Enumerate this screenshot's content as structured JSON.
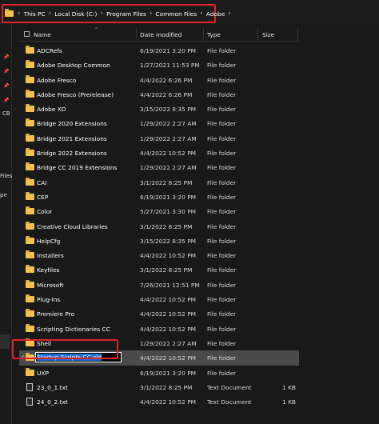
{
  "breadcrumb": {
    "items": [
      "This PC",
      "Local Disk (C:)",
      "Program Files",
      "Common Files",
      "Adobe"
    ],
    "separator": "›"
  },
  "nav_pane": {
    "labels": [
      "CB",
      "Files",
      "pe"
    ]
  },
  "columns": {
    "name": "Name",
    "date_modified": "Date modified",
    "type": "Type",
    "size": "Size"
  },
  "files": [
    {
      "name": "ADCRefs",
      "date": "6/19/2021 3:20 PM",
      "type": "File folder",
      "size": "",
      "kind": "folder"
    },
    {
      "name": "Adobe Desktop Common",
      "date": "1/27/2021 11:53 PM",
      "type": "File folder",
      "size": "",
      "kind": "folder"
    },
    {
      "name": "Adobe Fresco",
      "date": "4/4/2022 6:26 PM",
      "type": "File folder",
      "size": "",
      "kind": "folder"
    },
    {
      "name": "Adobe Fresco (Prerelease)",
      "date": "4/4/2022 6:26 PM",
      "type": "File folder",
      "size": "",
      "kind": "folder"
    },
    {
      "name": "Adobe XD",
      "date": "3/15/2022 8:35 PM",
      "type": "File folder",
      "size": "",
      "kind": "folder"
    },
    {
      "name": "Bridge 2020 Extensions",
      "date": "1/29/2022 2:27 AM",
      "type": "File folder",
      "size": "",
      "kind": "folder"
    },
    {
      "name": "Bridge 2021 Extensions",
      "date": "1/29/2022 2:27 AM",
      "type": "File folder",
      "size": "",
      "kind": "folder"
    },
    {
      "name": "Bridge 2022 Extensions",
      "date": "4/4/2022 10:52 PM",
      "type": "File folder",
      "size": "",
      "kind": "folder"
    },
    {
      "name": "Bridge CC 2019 Extensions",
      "date": "1/29/2022 2:27 AM",
      "type": "File folder",
      "size": "",
      "kind": "folder"
    },
    {
      "name": "CAI",
      "date": "3/1/2022 8:25 PM",
      "type": "File folder",
      "size": "",
      "kind": "folder"
    },
    {
      "name": "CEP",
      "date": "6/19/2021 3:20 PM",
      "type": "File folder",
      "size": "",
      "kind": "folder"
    },
    {
      "name": "Color",
      "date": "5/27/2021 3:30 PM",
      "type": "File folder",
      "size": "",
      "kind": "folder"
    },
    {
      "name": "Creative Cloud Libraries",
      "date": "3/1/2022 8:25 PM",
      "type": "File folder",
      "size": "",
      "kind": "folder"
    },
    {
      "name": "HelpCfg",
      "date": "3/15/2022 8:35 PM",
      "type": "File folder",
      "size": "",
      "kind": "folder"
    },
    {
      "name": "Installers",
      "date": "4/4/2022 10:52 PM",
      "type": "File folder",
      "size": "",
      "kind": "folder"
    },
    {
      "name": "Keyfiles",
      "date": "3/1/2022 8:25 PM",
      "type": "File folder",
      "size": "",
      "kind": "folder"
    },
    {
      "name": "Microsoft",
      "date": "7/26/2021 12:51 PM",
      "type": "File folder",
      "size": "",
      "kind": "folder"
    },
    {
      "name": "Plug-Ins",
      "date": "4/4/2022 10:52 PM",
      "type": "File folder",
      "size": "",
      "kind": "folder"
    },
    {
      "name": "Premiere Pro",
      "date": "4/4/2022 10:52 PM",
      "type": "File folder",
      "size": "",
      "kind": "folder"
    },
    {
      "name": "Scripting Dictionaries CC",
      "date": "4/4/2022 10:52 PM",
      "type": "File folder",
      "size": "",
      "kind": "folder"
    },
    {
      "name": "Shell",
      "date": "1/29/2022 2:27 AM",
      "type": "File folder",
      "size": "",
      "kind": "folder"
    },
    {
      "name": "Startup Scripts CC.old",
      "date": "4/4/2022 10:52 PM",
      "type": "File folder",
      "size": "",
      "kind": "folder",
      "selected": true,
      "renaming": true
    },
    {
      "name": "UXP",
      "date": "6/19/2021 3:20 PM",
      "type": "File folder",
      "size": "",
      "kind": "folder"
    },
    {
      "name": "23_0_1.txt",
      "date": "3/1/2022 8:25 PM",
      "type": "Text Document",
      "size": "1 KB",
      "kind": "file"
    },
    {
      "name": "24_0_2.txt",
      "date": "4/4/2022 10:52 PM",
      "type": "Text Document",
      "size": "1 KB",
      "kind": "file"
    }
  ],
  "colors": {
    "highlight": "#e0202a",
    "folder": "#f2c14e",
    "selection": "#1f6fd1",
    "background": "#191919"
  }
}
